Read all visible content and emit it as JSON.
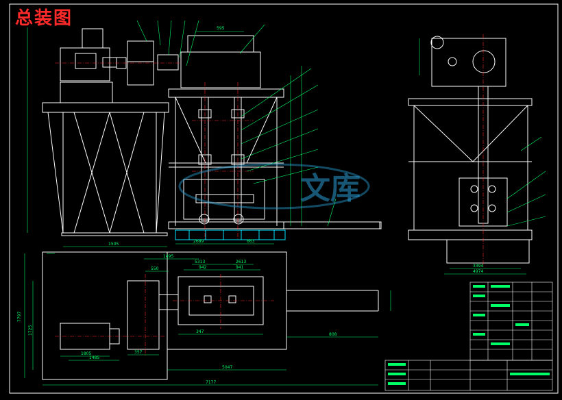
{
  "drawing": {
    "title": "总装图",
    "watermark": "文库"
  },
  "dimensions": {
    "front_top_width": "595",
    "front_left_base_width": "1505",
    "front_bottom_1": "2689",
    "front_bottom_2": "663",
    "plan_top_1": "1495",
    "plan_top_2": "5313",
    "plan_top_3": "2613",
    "plan_mid_1": "550",
    "plan_mid_2": "942",
    "plan_mid_3": "941",
    "plan_left_height": "7797",
    "plan_left_inner": "1725",
    "plan_bottom_1": "1805",
    "plan_bottom_2": "1485",
    "plan_bottom_3": "357",
    "plan_bottom_4": "347",
    "plan_total": "5047",
    "plan_overall": "7177",
    "plan_right": "808",
    "side_base_1": "3394",
    "side_base_2": "4974"
  },
  "colors": {
    "frame": "#ffffff",
    "dimension": "#00ff66",
    "leader": "#00ff66",
    "centerline": "#ff2a2a",
    "base": "#00e5ff",
    "title": "#ff2a2a"
  }
}
